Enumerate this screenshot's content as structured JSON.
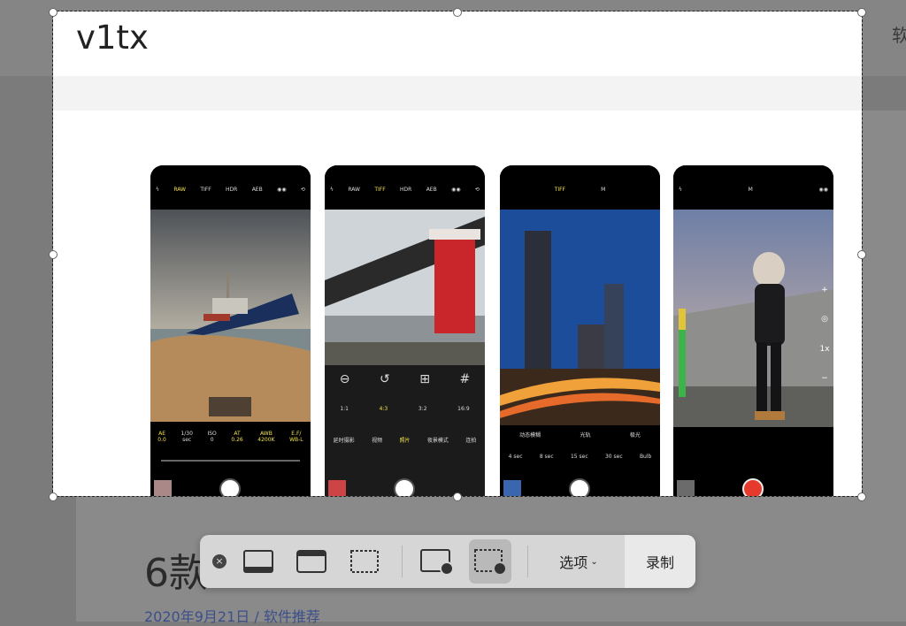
{
  "background": {
    "right_nav_text": "软",
    "article_title": "6款",
    "article_meta": "2020年9月21日 / 软件推荐"
  },
  "selection": {
    "site_title": "v1tx"
  },
  "phones": [
    {
      "top_labels": [
        "RAW",
        "TIFF",
        "HDR",
        "AEB"
      ],
      "active_label": "RAW",
      "exposure": [
        {
          "label": "AE",
          "value": "0.0"
        },
        {
          "label": "1/30",
          "value": "sec"
        },
        {
          "label": "ISO",
          "value": "0"
        },
        {
          "label": "AT",
          "value": "0.26"
        },
        {
          "label": "AWB",
          "value": "4200K"
        },
        {
          "label": "E.F/",
          "value": "WB-L"
        }
      ]
    },
    {
      "top_labels": [
        "RAW",
        "TIFF",
        "HDR",
        "AEB"
      ],
      "active_label": "TIFF",
      "ratios": [
        "1:1",
        "4:3",
        "3:2",
        "16:9"
      ],
      "modes": [
        "延时摄影",
        "视频",
        "照片",
        "夜景模式",
        "连拍"
      ]
    },
    {
      "top_labels": [
        "TIFF",
        "M"
      ],
      "modes": [
        "动态模糊",
        "光轨",
        "极光"
      ],
      "durations": [
        "4 sec",
        "8 sec",
        "15 sec",
        "30 sec",
        "Bulb"
      ]
    },
    {
      "top_labels": [
        "M"
      ],
      "side_controls": [
        "+",
        "◎",
        "1x",
        "−"
      ]
    }
  ],
  "toolbar": {
    "close": "×",
    "options_label": "选项",
    "record_label": "录制"
  },
  "colors": {
    "accent_yellow": "#f4e24a",
    "record_red": "#e53a2c",
    "dim": "#7b7b7b"
  }
}
